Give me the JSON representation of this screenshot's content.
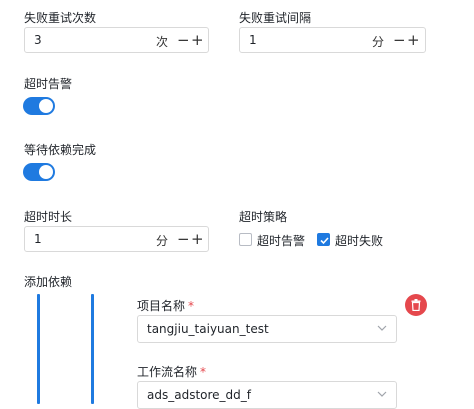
{
  "retry": {
    "count_label": "失败重试次数",
    "count_value": "3",
    "count_unit": "次",
    "interval_label": "失败重试间隔",
    "interval_value": "1",
    "interval_unit": "分"
  },
  "stepper": {
    "minus": "−",
    "plus": "+"
  },
  "timeout_alarm": {
    "label": "超时告警",
    "enabled": true
  },
  "wait_dependency": {
    "label": "等待依赖完成",
    "enabled": true
  },
  "timeout": {
    "duration_label": "超时时长",
    "duration_value": "1",
    "duration_unit": "分",
    "strategy_label": "超时策略",
    "options": [
      {
        "label": "超时告警",
        "checked": false
      },
      {
        "label": "超时失败",
        "checked": true
      }
    ]
  },
  "dependency": {
    "section_label": "添加依赖",
    "project_label": "项目名称",
    "project_value": "tangjiu_taiyuan_test",
    "workflow_label": "工作流名称",
    "workflow_value": "ads_adstore_dd_f",
    "required_mark": "*"
  },
  "colors": {
    "accent": "#1f7ae0",
    "danger": "#e5484d"
  }
}
